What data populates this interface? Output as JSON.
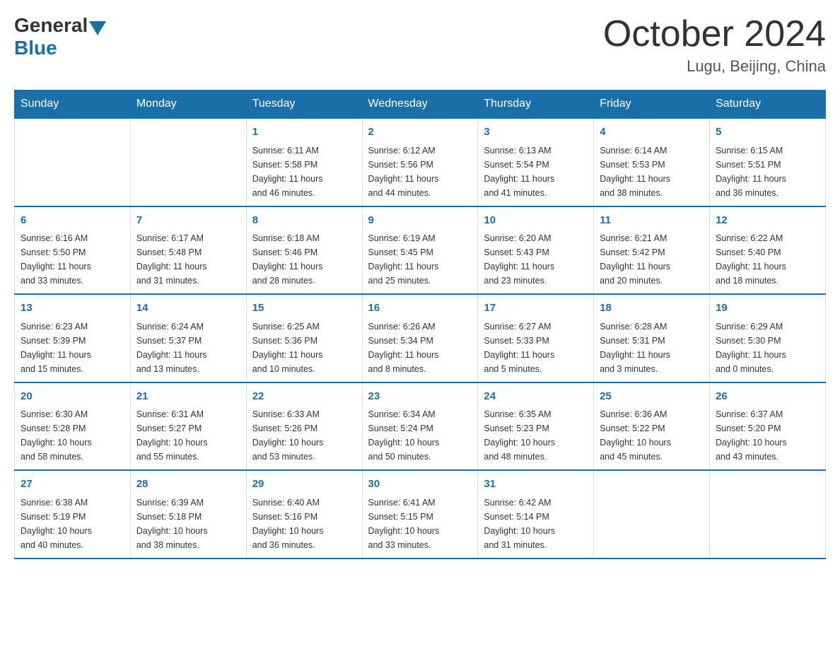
{
  "header": {
    "logo_general": "General",
    "logo_blue": "Blue",
    "title": "October 2024",
    "subtitle": "Lugu, Beijing, China"
  },
  "days_of_week": [
    "Sunday",
    "Monday",
    "Tuesday",
    "Wednesday",
    "Thursday",
    "Friday",
    "Saturday"
  ],
  "weeks": [
    [
      {
        "day": "",
        "info": ""
      },
      {
        "day": "",
        "info": ""
      },
      {
        "day": "1",
        "info": "Sunrise: 6:11 AM\nSunset: 5:58 PM\nDaylight: 11 hours\nand 46 minutes."
      },
      {
        "day": "2",
        "info": "Sunrise: 6:12 AM\nSunset: 5:56 PM\nDaylight: 11 hours\nand 44 minutes."
      },
      {
        "day": "3",
        "info": "Sunrise: 6:13 AM\nSunset: 5:54 PM\nDaylight: 11 hours\nand 41 minutes."
      },
      {
        "day": "4",
        "info": "Sunrise: 6:14 AM\nSunset: 5:53 PM\nDaylight: 11 hours\nand 38 minutes."
      },
      {
        "day": "5",
        "info": "Sunrise: 6:15 AM\nSunset: 5:51 PM\nDaylight: 11 hours\nand 36 minutes."
      }
    ],
    [
      {
        "day": "6",
        "info": "Sunrise: 6:16 AM\nSunset: 5:50 PM\nDaylight: 11 hours\nand 33 minutes."
      },
      {
        "day": "7",
        "info": "Sunrise: 6:17 AM\nSunset: 5:48 PM\nDaylight: 11 hours\nand 31 minutes."
      },
      {
        "day": "8",
        "info": "Sunrise: 6:18 AM\nSunset: 5:46 PM\nDaylight: 11 hours\nand 28 minutes."
      },
      {
        "day": "9",
        "info": "Sunrise: 6:19 AM\nSunset: 5:45 PM\nDaylight: 11 hours\nand 25 minutes."
      },
      {
        "day": "10",
        "info": "Sunrise: 6:20 AM\nSunset: 5:43 PM\nDaylight: 11 hours\nand 23 minutes."
      },
      {
        "day": "11",
        "info": "Sunrise: 6:21 AM\nSunset: 5:42 PM\nDaylight: 11 hours\nand 20 minutes."
      },
      {
        "day": "12",
        "info": "Sunrise: 6:22 AM\nSunset: 5:40 PM\nDaylight: 11 hours\nand 18 minutes."
      }
    ],
    [
      {
        "day": "13",
        "info": "Sunrise: 6:23 AM\nSunset: 5:39 PM\nDaylight: 11 hours\nand 15 minutes."
      },
      {
        "day": "14",
        "info": "Sunrise: 6:24 AM\nSunset: 5:37 PM\nDaylight: 11 hours\nand 13 minutes."
      },
      {
        "day": "15",
        "info": "Sunrise: 6:25 AM\nSunset: 5:36 PM\nDaylight: 11 hours\nand 10 minutes."
      },
      {
        "day": "16",
        "info": "Sunrise: 6:26 AM\nSunset: 5:34 PM\nDaylight: 11 hours\nand 8 minutes."
      },
      {
        "day": "17",
        "info": "Sunrise: 6:27 AM\nSunset: 5:33 PM\nDaylight: 11 hours\nand 5 minutes."
      },
      {
        "day": "18",
        "info": "Sunrise: 6:28 AM\nSunset: 5:31 PM\nDaylight: 11 hours\nand 3 minutes."
      },
      {
        "day": "19",
        "info": "Sunrise: 6:29 AM\nSunset: 5:30 PM\nDaylight: 11 hours\nand 0 minutes."
      }
    ],
    [
      {
        "day": "20",
        "info": "Sunrise: 6:30 AM\nSunset: 5:28 PM\nDaylight: 10 hours\nand 58 minutes."
      },
      {
        "day": "21",
        "info": "Sunrise: 6:31 AM\nSunset: 5:27 PM\nDaylight: 10 hours\nand 55 minutes."
      },
      {
        "day": "22",
        "info": "Sunrise: 6:33 AM\nSunset: 5:26 PM\nDaylight: 10 hours\nand 53 minutes."
      },
      {
        "day": "23",
        "info": "Sunrise: 6:34 AM\nSunset: 5:24 PM\nDaylight: 10 hours\nand 50 minutes."
      },
      {
        "day": "24",
        "info": "Sunrise: 6:35 AM\nSunset: 5:23 PM\nDaylight: 10 hours\nand 48 minutes."
      },
      {
        "day": "25",
        "info": "Sunrise: 6:36 AM\nSunset: 5:22 PM\nDaylight: 10 hours\nand 45 minutes."
      },
      {
        "day": "26",
        "info": "Sunrise: 6:37 AM\nSunset: 5:20 PM\nDaylight: 10 hours\nand 43 minutes."
      }
    ],
    [
      {
        "day": "27",
        "info": "Sunrise: 6:38 AM\nSunset: 5:19 PM\nDaylight: 10 hours\nand 40 minutes."
      },
      {
        "day": "28",
        "info": "Sunrise: 6:39 AM\nSunset: 5:18 PM\nDaylight: 10 hours\nand 38 minutes."
      },
      {
        "day": "29",
        "info": "Sunrise: 6:40 AM\nSunset: 5:16 PM\nDaylight: 10 hours\nand 36 minutes."
      },
      {
        "day": "30",
        "info": "Sunrise: 6:41 AM\nSunset: 5:15 PM\nDaylight: 10 hours\nand 33 minutes."
      },
      {
        "day": "31",
        "info": "Sunrise: 6:42 AM\nSunset: 5:14 PM\nDaylight: 10 hours\nand 31 minutes."
      },
      {
        "day": "",
        "info": ""
      },
      {
        "day": "",
        "info": ""
      }
    ]
  ]
}
